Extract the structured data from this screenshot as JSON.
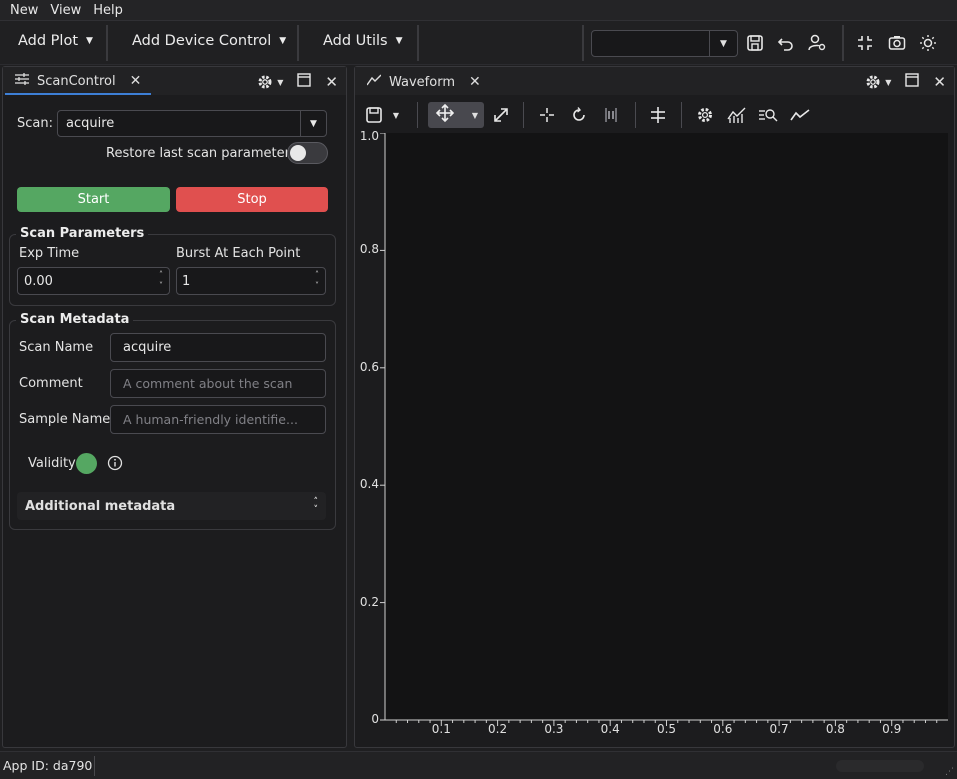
{
  "menu": [
    "New",
    "View",
    "Help"
  ],
  "toolbar": {
    "add_plot": "Add Plot",
    "add_device_control": "Add Device Control",
    "add_utils": "Add Utils",
    "profile_value": ""
  },
  "scan_control": {
    "tab_label": "ScanControl",
    "scan_label": "Scan:",
    "scan_value": "acquire",
    "restore_label": "Restore last scan parameters",
    "restore_on": false,
    "start_label": "Start",
    "stop_label": "Stop",
    "params": {
      "title": "Scan Parameters",
      "exp_time_label": "Exp Time",
      "exp_time_value": "0.00",
      "burst_label": "Burst At Each Point",
      "burst_value": "1"
    },
    "metadata": {
      "title": "Scan Metadata",
      "scan_name_label": "Scan Name",
      "scan_name_value": "acquire",
      "comment_label": "Comment",
      "comment_placeholder": "A comment about the scan",
      "sample_label": "Sample Name",
      "sample_placeholder": "A human-friendly identifie...",
      "validity_label": "Validity",
      "validity_color": "#55a762",
      "additional_label": "Additional metadata"
    }
  },
  "waveform": {
    "tab_label": "Waveform",
    "y_ticks": [
      "1.0",
      "0.8",
      "0.6",
      "0.4",
      "0.2",
      "0"
    ],
    "x_ticks": [
      "0.1",
      "0.2",
      "0.3",
      "0.4",
      "0.5",
      "0.6",
      "0.7",
      "0.8",
      "0.9"
    ]
  },
  "chart_data": {
    "type": "line",
    "x": [],
    "y": [],
    "xlim": [
      0,
      1
    ],
    "ylim": [
      0,
      1
    ],
    "grid": false
  },
  "status": {
    "app_id": "App ID: da790"
  },
  "colors": {
    "accent": "#3d7fd6",
    "start": "#55a762",
    "stop": "#e0504f"
  }
}
